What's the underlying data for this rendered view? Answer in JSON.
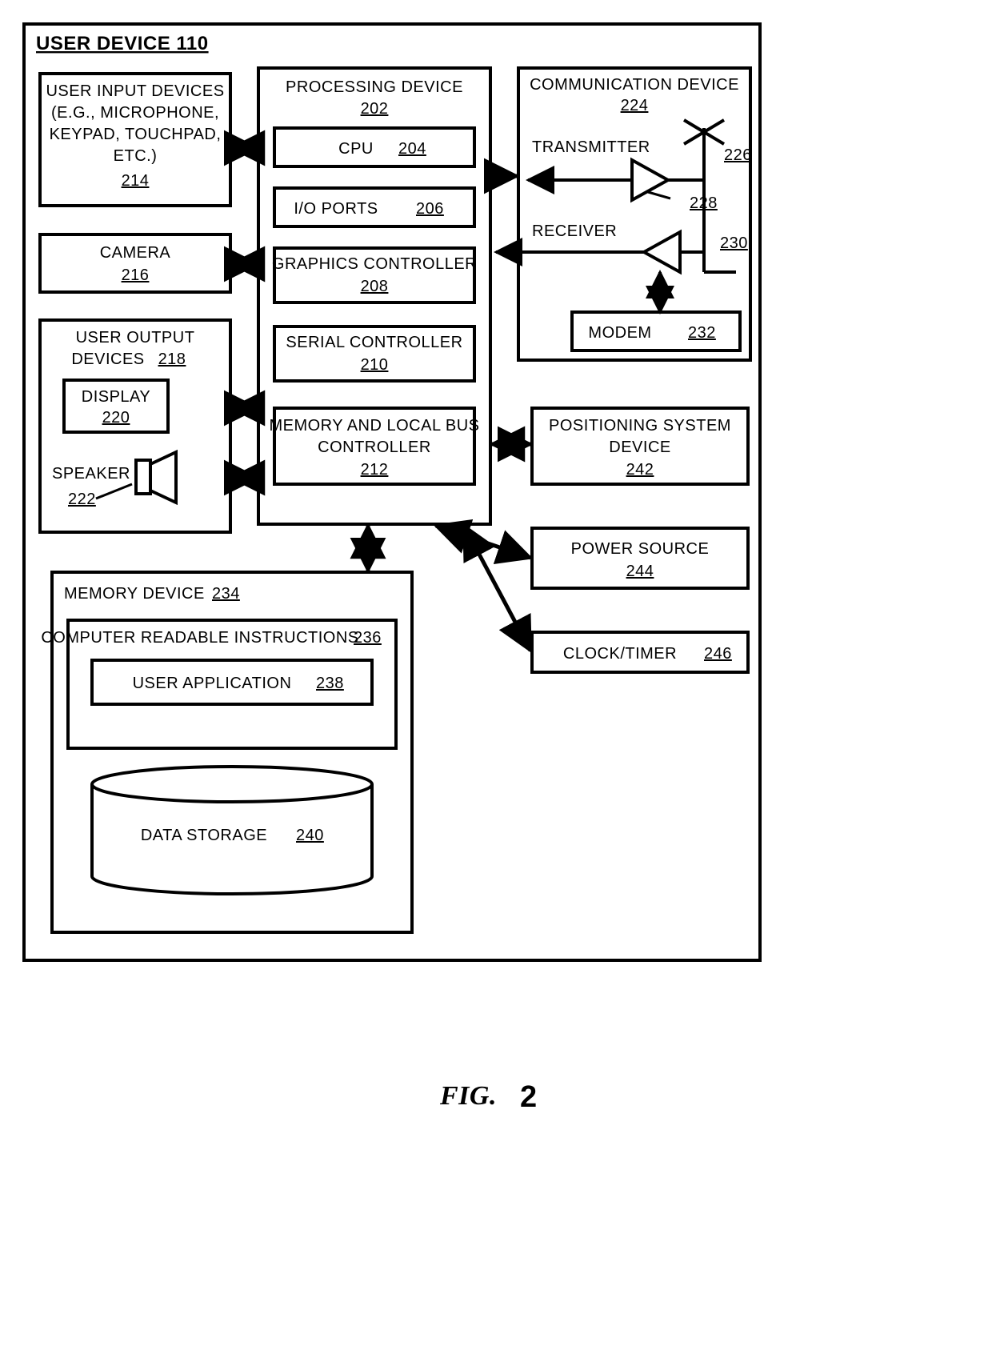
{
  "outer": {
    "title": "USER DEVICE 110"
  },
  "left": {
    "input": {
      "l1": "USER INPUT DEVICES",
      "l2": "(E.G., MICROPHONE,",
      "l3": "KEYPAD, TOUCHPAD,",
      "l4": "ETC.)",
      "ref": "214"
    },
    "camera": {
      "label": "CAMERA",
      "ref": "216"
    },
    "output": {
      "label": "USER OUTPUT",
      "label2": "DEVICES",
      "ref": "218",
      "display": {
        "label": "DISPLAY",
        "ref": "220"
      },
      "speaker": {
        "label": "SPEAKER",
        "ref": "222"
      }
    }
  },
  "center": {
    "title": "PROCESSING DEVICE",
    "ref": "202",
    "cpu": {
      "label": "CPU",
      "ref": "204"
    },
    "io": {
      "label": "I/O PORTS",
      "ref": "206"
    },
    "gfx": {
      "label": "GRAPHICS CONTROLLER",
      "ref": "208"
    },
    "serial": {
      "label": "SERIAL CONTROLLER",
      "ref": "210"
    },
    "membus": {
      "l1": "MEMORY AND LOCAL BUS",
      "l2": "CONTROLLER",
      "ref": "212"
    }
  },
  "comm": {
    "title": "COMMUNICATION DEVICE",
    "ref": "224",
    "tx": "TRANSMITTER",
    "rx": "RECEIVER",
    "modem": {
      "label": "MODEM",
      "ref": "232"
    },
    "ref226": "226",
    "ref228": "228",
    "ref230": "230"
  },
  "right": {
    "pos": {
      "l1": "POSITIONING SYSTEM",
      "l2": "DEVICE",
      "ref": "242"
    },
    "pwr": {
      "label": "POWER SOURCE",
      "ref": "244"
    },
    "clk": {
      "label": "CLOCK/TIMER",
      "ref": "246"
    }
  },
  "mem": {
    "title": "MEMORY DEVICE",
    "ref": "234",
    "cri": {
      "label": "COMPUTER READABLE INSTRUCTIONS",
      "ref": "236"
    },
    "app": {
      "label": "USER APPLICATION",
      "ref": "238"
    },
    "ds": {
      "label": "DATA STORAGE",
      "ref": "240"
    }
  },
  "fig": {
    "pre": "FIG.",
    "num": "2"
  }
}
